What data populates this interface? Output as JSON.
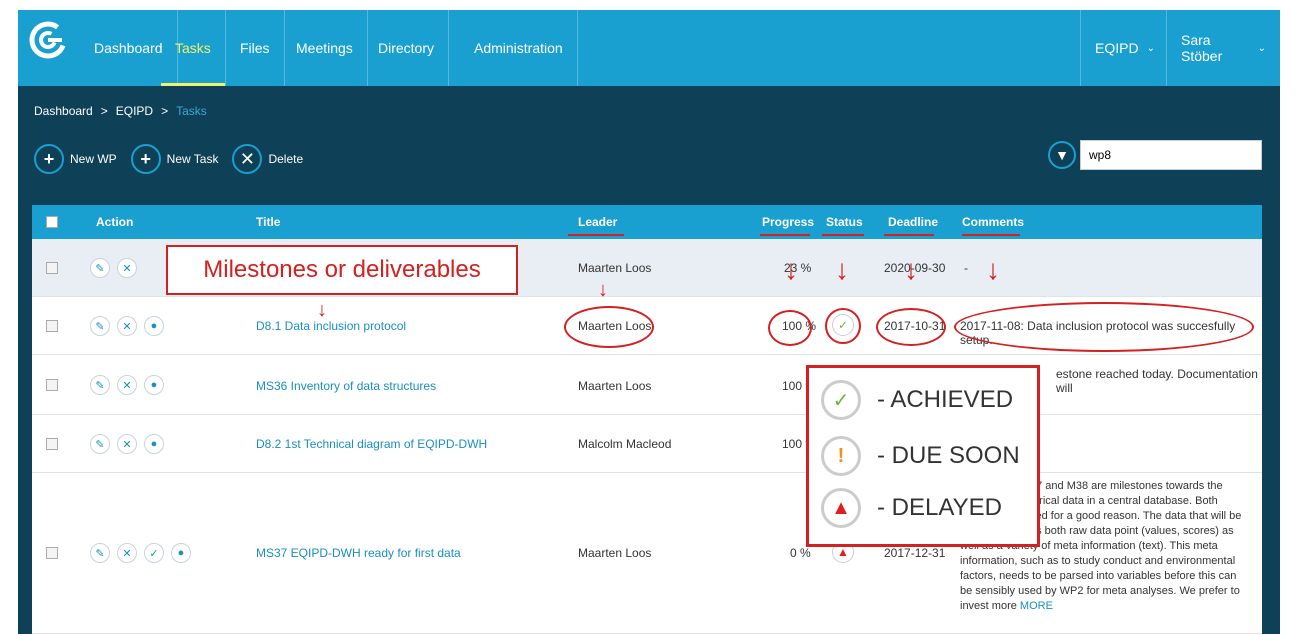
{
  "nav": {
    "items": [
      "Dashboard",
      "Tasks",
      "Files",
      "Meetings",
      "Directory",
      "Administration"
    ],
    "project": "EQIPD",
    "user": "Sara Stöber"
  },
  "breadcrumb": [
    "Dashboard",
    "EQIPD",
    "Tasks"
  ],
  "toolbar": {
    "new_wp": "New WP",
    "new_task": "New Task",
    "delete": "Delete"
  },
  "filter": {
    "value": "wp8"
  },
  "table": {
    "headers": {
      "action": "Action",
      "title": "Title",
      "leader": "Leader",
      "progress": "Progress",
      "status": "Status",
      "deadline": "Deadline",
      "comments": "Comments"
    },
    "rows": [
      {
        "title": "",
        "leader": "Maarten Loos",
        "progress": "23 %",
        "status": "",
        "deadline": "2020-09-30",
        "comment": "-"
      },
      {
        "title": "D8.1 Data inclusion protocol",
        "leader": "Maarten Loos",
        "progress": "100 %",
        "status": "achieved",
        "deadline": "2017-10-31",
        "comment": "2017-11-08: Data inclusion protocol was succesfully setup."
      },
      {
        "title": "MS36 Inventory of data structures",
        "leader": "Maarten Loos",
        "progress": "100 %",
        "status": "achieved",
        "deadline": "",
        "comment": "estone reached today. Documentation will"
      },
      {
        "title": "D8.2 1st Technical diagram of EQIPD-DWH",
        "leader": "Malcolm Macleod",
        "progress": "100 %",
        "status": "achieved",
        "deadline": "",
        "comment": ""
      },
      {
        "title": "MS37 EQIPD-DWH ready for first data",
        "leader": "Maarten Loos",
        "progress": "0 %",
        "status": "delayed",
        "deadline": "2017-12-31",
        "comment_lines": [
          "37 and M38 are milestones towards the",
          "torical data in a central database. Both",
          "ved for a good reason. The data that will be",
          "ns both raw data point (values, scores) as",
          "well as a variety of meta information (text). This meta",
          "information, such as to study conduct and environmental",
          "factors, needs to be parsed into variables before this can",
          "be sensibly used by WP2 for meta analyses. We prefer to"
        ],
        "comment_last": "invest more",
        "more": "MORE"
      }
    ]
  },
  "annotation": {
    "box_label": "Milestones or deliverables",
    "legend": [
      {
        "icon": "check-icon",
        "label": "- ACHIEVED",
        "color": "#6db33f"
      },
      {
        "icon": "exclamation-icon",
        "label": "- DUE SOON",
        "color": "#f0901e"
      },
      {
        "icon": "bell-icon",
        "label": "- DELAYED",
        "color": "#e02020"
      }
    ],
    "color": "#d42020"
  },
  "colors": {
    "nav": "#1aa0d0",
    "content_bg": "#0e4057",
    "active_tab": "#f2f26a",
    "link": "#1a8fc0"
  }
}
